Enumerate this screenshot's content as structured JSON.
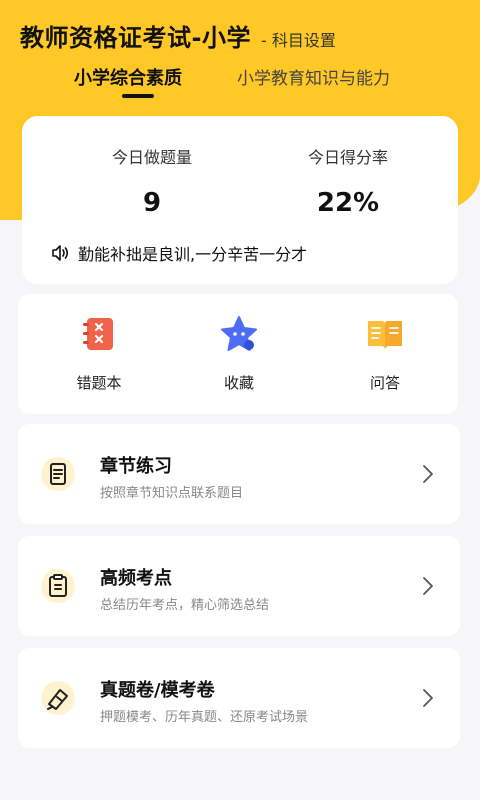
{
  "header": {
    "title": "教师资格证考试-小学",
    "subject_settings": "- 科目设置"
  },
  "tabs": [
    {
      "label": "小学综合素质",
      "active": true
    },
    {
      "label": "小学教育知识与能力",
      "active": false
    }
  ],
  "stats": {
    "today_count_label": "今日做题量",
    "today_count_value": "9",
    "today_score_label": "今日得分率",
    "today_score_value": "22%"
  },
  "motto": {
    "icon": "speaker-icon",
    "text": "勤能补拙是良训,一分辛苦一分才"
  },
  "shortcuts": [
    {
      "label": "错题本",
      "icon": "wrong-notebook-icon"
    },
    {
      "label": "收藏",
      "icon": "star-favorite-icon"
    },
    {
      "label": "问答",
      "icon": "open-book-qa-icon"
    }
  ],
  "menu": [
    {
      "title": "章节练习",
      "subtitle": "按照章节知识点联系题目",
      "icon": "list-document-icon"
    },
    {
      "title": "高频考点",
      "subtitle": "总结历年考点，精心筛选总结",
      "icon": "clipboard-icon"
    },
    {
      "title": "真题卷/模考卷",
      "subtitle": "押题模考、历年真题、还原考试场景",
      "icon": "exam-paper-pen-icon"
    }
  ],
  "colors": {
    "accent": "#ffc826",
    "red_icon": "#f0624a",
    "blue_icon": "#4d6cf5",
    "gold_icon": "#fbbf3c"
  }
}
